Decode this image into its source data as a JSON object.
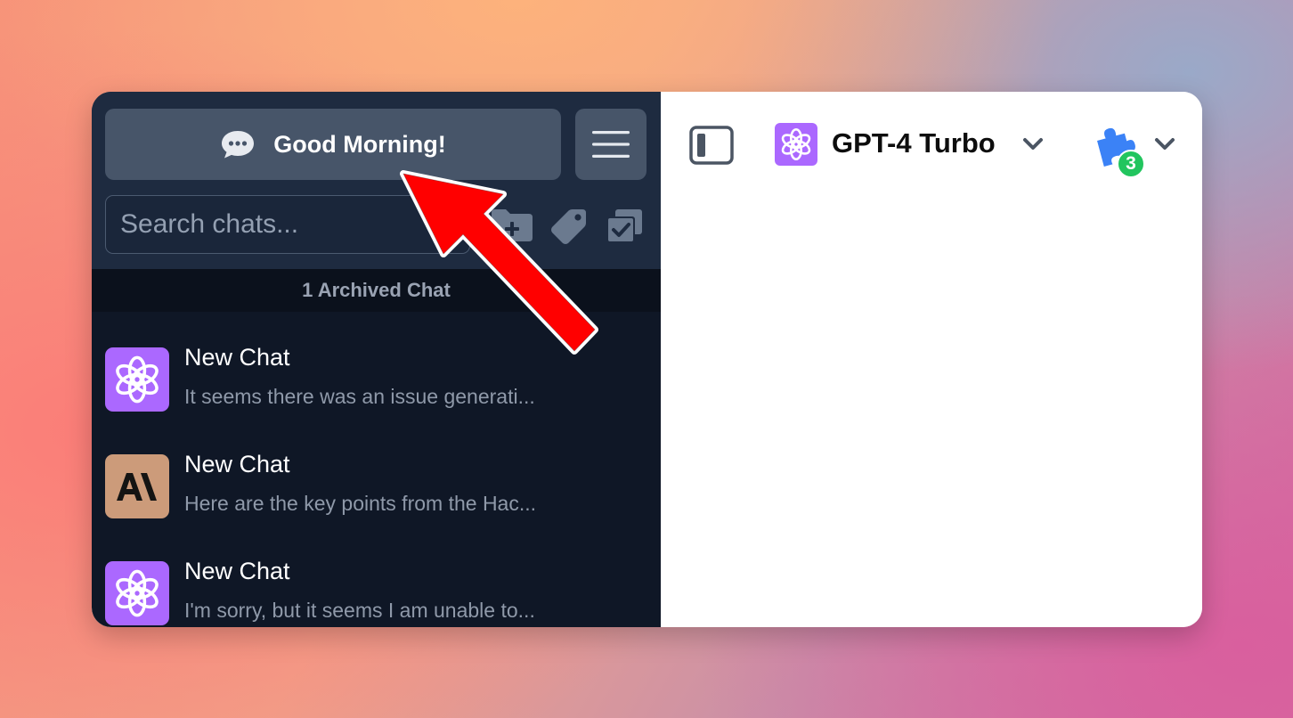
{
  "sidebar": {
    "greeting": "Good Morning!",
    "search_placeholder": "Search chats...",
    "archived_label": "1 Archived Chat",
    "chats": [
      {
        "title": "New Chat",
        "preview": "It seems there was an issue generati...",
        "avatar": "openai-icon",
        "avatar_color": "#ab68ff"
      },
      {
        "title": "New Chat",
        "preview": "Here are the key points from the Hac...",
        "avatar": "anthropic-icon",
        "avatar_color": "#cc9b7a"
      },
      {
        "title": "New Chat",
        "preview": "I'm sorry, but it seems I am unable to...",
        "avatar": "openai-icon",
        "avatar_color": "#ab68ff"
      }
    ]
  },
  "header": {
    "model_name": "GPT-4 Turbo",
    "plugin_count": "3"
  },
  "colors": {
    "sidebar_bg": "#0f1726",
    "sidebar_top_bg": "#1e2b40",
    "button_bg": "#475569",
    "openai_purple": "#ab68ff",
    "anthropic_tan": "#cc9b7a",
    "badge_green": "#22c55e",
    "plugin_blue": "#3b82f6",
    "annotation_arrow": "#ff0000"
  }
}
